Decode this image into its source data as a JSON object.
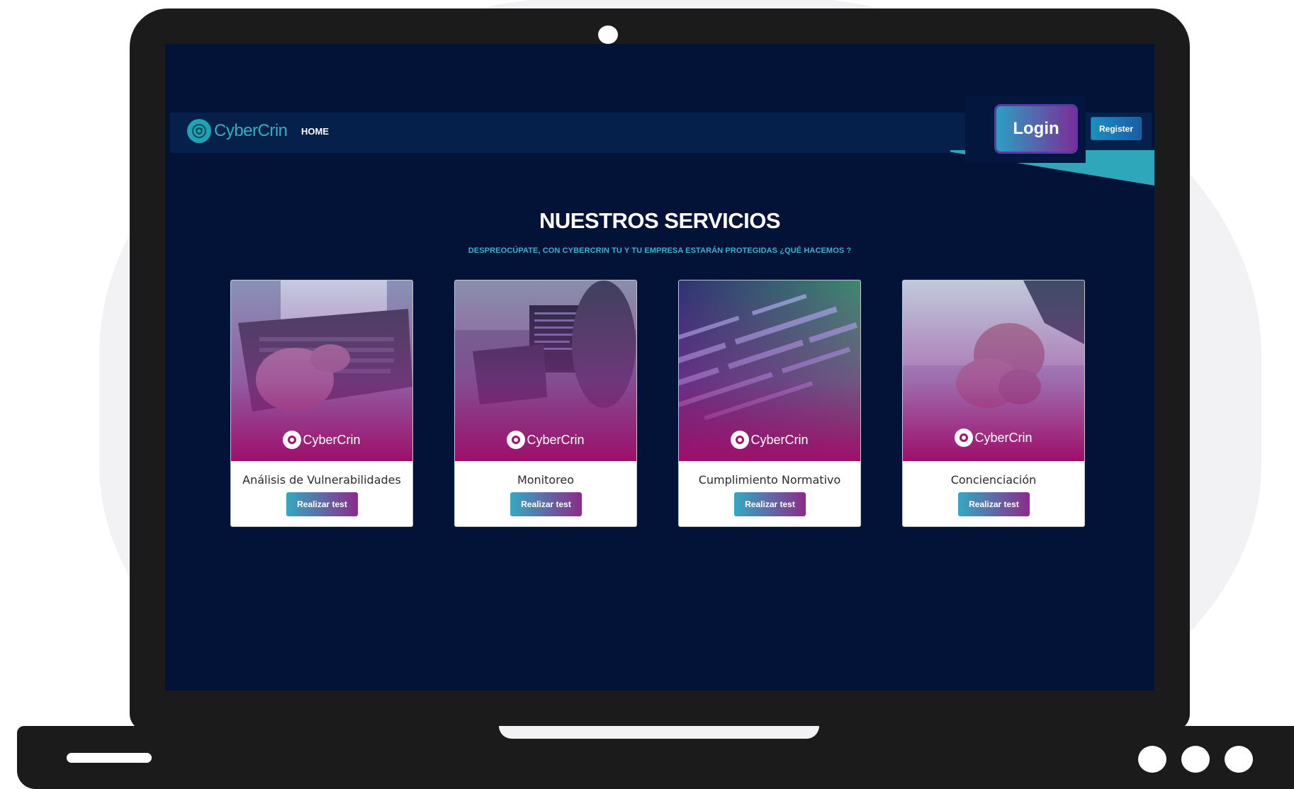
{
  "brand": {
    "name": "CyberCrin"
  },
  "nav": {
    "home": "HOME",
    "login": "Login",
    "register": "Register"
  },
  "section": {
    "title": "NUESTROS SERVICIOS",
    "subtitle": "DESPREOCÚPATE, CON CYBERCRIN TU Y TU EMPRESA ESTARÁN PROTEGIDAS ¿QUÉ HACEMOS ?"
  },
  "cards": [
    {
      "title": "Análisis de Vulnerabilidades",
      "button": "Realizar test",
      "logo": "CyberCrin",
      "image": "laptop-typing"
    },
    {
      "title": "Monitoreo",
      "button": "Realizar test",
      "logo": "CyberCrin",
      "image": "code-monitor"
    },
    {
      "title": "Cumplimiento Normativo",
      "button": "Realizar test",
      "logo": "CyberCrin",
      "image": "code-screen"
    },
    {
      "title": "Concienciación",
      "button": "Realizar test",
      "logo": "CyberCrin",
      "image": "hands-together"
    }
  ],
  "colors": {
    "screen_bg": "#021337",
    "navbar_bg": "#05204a",
    "accent_teal": "#2fb0c3",
    "accent_magenta": "#9e0f6b",
    "subtitle": "#38b3d1"
  }
}
